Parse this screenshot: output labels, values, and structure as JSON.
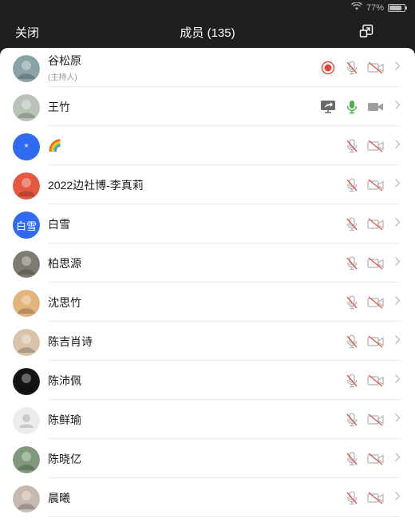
{
  "status": {
    "battery": "77%",
    "battery_level": 0.77
  },
  "header": {
    "close_label": "关闭",
    "title": "成员 (135)"
  },
  "members": [
    {
      "name": "谷松原",
      "role": "(主持人)",
      "avatar": "photo",
      "avatar_text": "",
      "avatar_color": "#8aa3a8",
      "recording": true,
      "share": false,
      "mic": "muted",
      "video": "off"
    },
    {
      "name": "王竹",
      "role": "",
      "avatar": "photo",
      "avatar_text": "",
      "avatar_color": "#b9c3b8",
      "recording": false,
      "share": true,
      "mic": "on",
      "video": "off-plain"
    },
    {
      "name": "🌈",
      "role": "",
      "avatar": "text",
      "avatar_text": "*",
      "avatar_color": "#2e6bf1",
      "recording": false,
      "share": false,
      "mic": "muted",
      "video": "off"
    },
    {
      "name": "2022边社博-李真莉",
      "role": "",
      "avatar": "photo",
      "avatar_text": "",
      "avatar_color": "#e5573f",
      "recording": false,
      "share": false,
      "mic": "muted",
      "video": "off"
    },
    {
      "name": "白雪",
      "role": "",
      "avatar": "text",
      "avatar_text": "白雪",
      "avatar_color": "#2e6bf1",
      "recording": false,
      "share": false,
      "mic": "muted",
      "video": "off"
    },
    {
      "name": "柏思源",
      "role": "",
      "avatar": "photo",
      "avatar_text": "",
      "avatar_color": "#7d7b72",
      "recording": false,
      "share": false,
      "mic": "muted",
      "video": "off"
    },
    {
      "name": "沈思竹",
      "role": "",
      "avatar": "photo",
      "avatar_text": "",
      "avatar_color": "#e2b37a",
      "recording": false,
      "share": false,
      "mic": "muted",
      "video": "off"
    },
    {
      "name": "陈吉肖诗",
      "role": "",
      "avatar": "photo",
      "avatar_text": "",
      "avatar_color": "#d9c2a9",
      "recording": false,
      "share": false,
      "mic": "muted",
      "video": "off"
    },
    {
      "name": "陈沛佩",
      "role": "",
      "avatar": "photo",
      "avatar_text": "",
      "avatar_color": "#141414",
      "recording": false,
      "share": false,
      "mic": "muted",
      "video": "off"
    },
    {
      "name": "陈鲜瑜",
      "role": "",
      "avatar": "default",
      "avatar_text": "",
      "avatar_color": "#e6e6e6",
      "recording": false,
      "share": false,
      "mic": "muted",
      "video": "off"
    },
    {
      "name": "陈晓亿",
      "role": "",
      "avatar": "photo",
      "avatar_text": "",
      "avatar_color": "#7f9a7a",
      "recording": false,
      "share": false,
      "mic": "muted",
      "video": "off"
    },
    {
      "name": "晨曦",
      "role": "",
      "avatar": "photo",
      "avatar_text": "",
      "avatar_color": "#c7b9b0",
      "recording": false,
      "share": false,
      "mic": "muted",
      "video": "off"
    }
  ]
}
